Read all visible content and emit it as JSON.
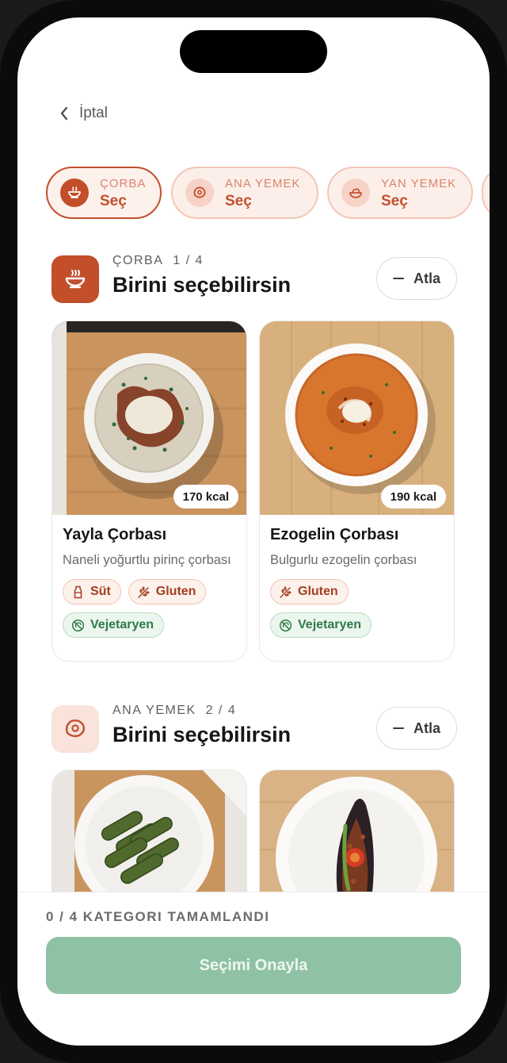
{
  "nav": {
    "back_label": "İptal"
  },
  "chips": [
    {
      "category": "ÇORBA",
      "action": "Seç",
      "icon": "soup-bowl-icon",
      "active": true
    },
    {
      "category": "ANA YEMEK",
      "action": "Seç",
      "icon": "meat-icon",
      "active": false
    },
    {
      "category": "YAN YEMEK",
      "action": "Seç",
      "icon": "side-dish-bowl-icon",
      "active": false
    }
  ],
  "sections": [
    {
      "category": "ÇORBA",
      "step": "1 / 4",
      "title": "Birini seçebilirsin",
      "skip_label": "Atla",
      "icon": "soup-bowl-icon",
      "items": [
        {
          "name": "Yayla Çorbası",
          "description": "Naneli yoğurtlu pirinç çorbası",
          "kcal": "170 kcal",
          "tags": [
            {
              "label": "Süt",
              "icon": "milk-bottle-icon",
              "kind": "allergen"
            },
            {
              "label": "Gluten",
              "icon": "wheat-icon",
              "kind": "allergen"
            },
            {
              "label": "Vejetaryen",
              "icon": "no-meat-icon",
              "kind": "diet"
            }
          ]
        },
        {
          "name": "Ezogelin Çorbası",
          "description": "Bulgurlu ezogelin çorbası",
          "kcal": "190 kcal",
          "tags": [
            {
              "label": "Gluten",
              "icon": "wheat-icon",
              "kind": "allergen"
            },
            {
              "label": "Vejetaryen",
              "icon": "no-meat-icon",
              "kind": "diet"
            }
          ]
        }
      ]
    },
    {
      "category": "ANA YEMEK",
      "step": "2 / 4",
      "title": "Birini seçebilirsin",
      "skip_label": "Atla",
      "icon": "meat-icon"
    }
  ],
  "footer": {
    "progress": "0 / 4 KATEGORI TAMAMLANDI",
    "confirm_label": "Seçimi Onayla"
  },
  "colors": {
    "accent": "#c24e2a",
    "accent_light": "#fdf1ec",
    "veg_green": "#2f7a49",
    "confirm_disabled": "#8fc2a4"
  }
}
